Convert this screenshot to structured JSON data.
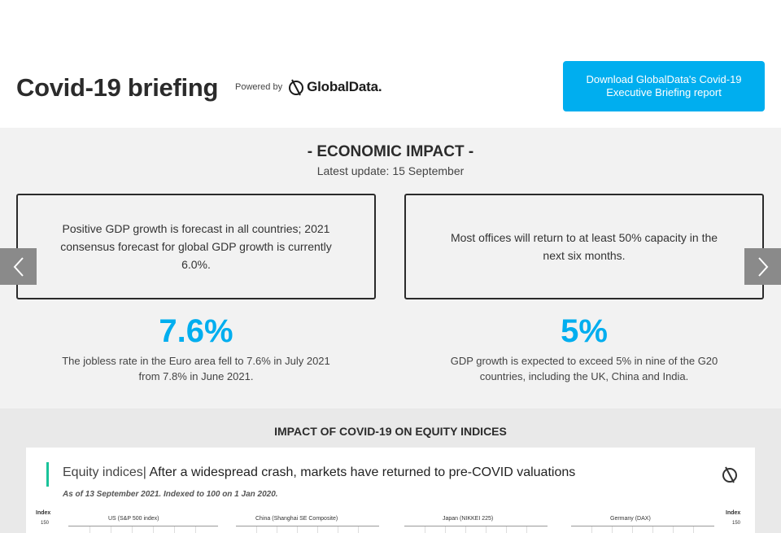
{
  "header": {
    "title": "Covid-19 briefing",
    "powered_by": "Powered by",
    "logo_text": "GlobalData.",
    "download_label": "Download GlobalData's Covid-19 Executive Briefing report"
  },
  "economic_impact": {
    "heading": "- ECONOMIC IMPACT -",
    "update": "Latest update: 15 September",
    "cards": [
      {
        "text": "Positive GDP growth is forecast in all countries; 2021 consensus forecast for global GDP growth is currently 6.0%."
      },
      {
        "text": "Most offices will return to at least 50% capacity in the next six months."
      }
    ],
    "stats": [
      {
        "value": "7.6%",
        "description": "The jobless rate in the Euro area fell to 7.6% in July 2021 from 7.8% in June 2021."
      },
      {
        "value": "5%",
        "description": "GDP growth is expected to exceed 5% in nine of the G20 countries, including the UK, China and India."
      }
    ],
    "prev_icon": "chevron-left-icon",
    "next_icon": "chevron-right-icon"
  },
  "equity": {
    "heading": "IMPACT OF COVID-19 ON EQUITY INDICES",
    "image": {
      "title_lead": "Equity indices|",
      "title_rest": " After a widespread crash, markets have returned to pre-COVID valuations",
      "subtitle": "As of 13 September 2021. Indexed to 100 on 1 Jan 2020.",
      "index_label": "Index",
      "tick_150": "150",
      "charts": [
        "US (S&P 500 index)",
        "China (Shanghai SE Composite)",
        "Japan (NIKKEI 225)",
        "Germany (DAX)"
      ]
    }
  },
  "colors": {
    "accent": "#00aeef",
    "dark_text": "#2b2b2b",
    "section_bg": "#f2f2f2",
    "equity_bg": "#e9e9e9",
    "teal": "#19c39a"
  }
}
